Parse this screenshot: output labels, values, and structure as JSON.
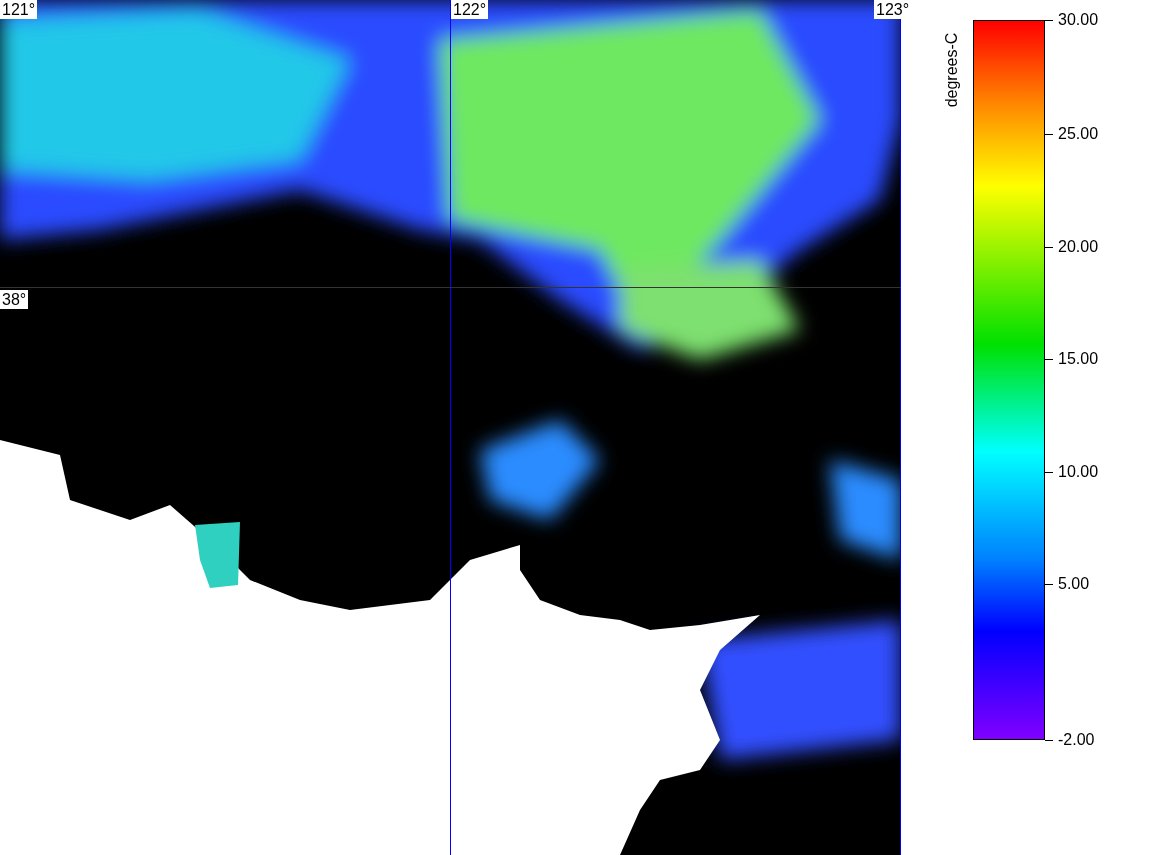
{
  "map": {
    "longitude_labels": [
      "121°",
      "122°",
      "123°"
    ],
    "latitude_labels": [
      "38°"
    ]
  },
  "colorbar": {
    "unit_label": "degrees-C",
    "ticks": [
      "30.00",
      "25.00",
      "20.00",
      "15.00",
      "10.00",
      "5.00",
      "-2.00"
    ]
  }
}
